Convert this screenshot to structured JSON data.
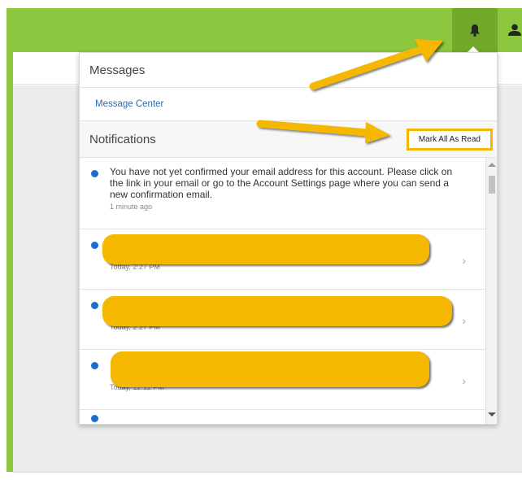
{
  "dropdown": {
    "messages_title": "Messages",
    "message_center_link": "Message Center",
    "notifications_title": "Notifications",
    "mark_all_label": "Mark All As Read"
  },
  "notifications": [
    {
      "text": "You have not yet confirmed your email address for this account. Please click on the link in your email or go to the Account Settings page where you can send a new confirmation email.",
      "time": "1 minute ago",
      "unread": true
    },
    {
      "text": "",
      "time": "Today, 2:27 PM",
      "unread": true
    },
    {
      "text": "",
      "time": "Today, 2:27 PM",
      "unread": true
    },
    {
      "text": "",
      "time": "Today, 12:12 PM",
      "unread": true
    }
  ],
  "icons": {
    "bell": "bell-icon",
    "user": "user-icon",
    "chevron": "chevron-right-icon"
  },
  "colors": {
    "header_green": "#8dc63f",
    "bell_active": "#72a92b",
    "unread_dot": "#1c6dd0",
    "annotation": "#f5b700",
    "link": "#2a6bb4"
  }
}
